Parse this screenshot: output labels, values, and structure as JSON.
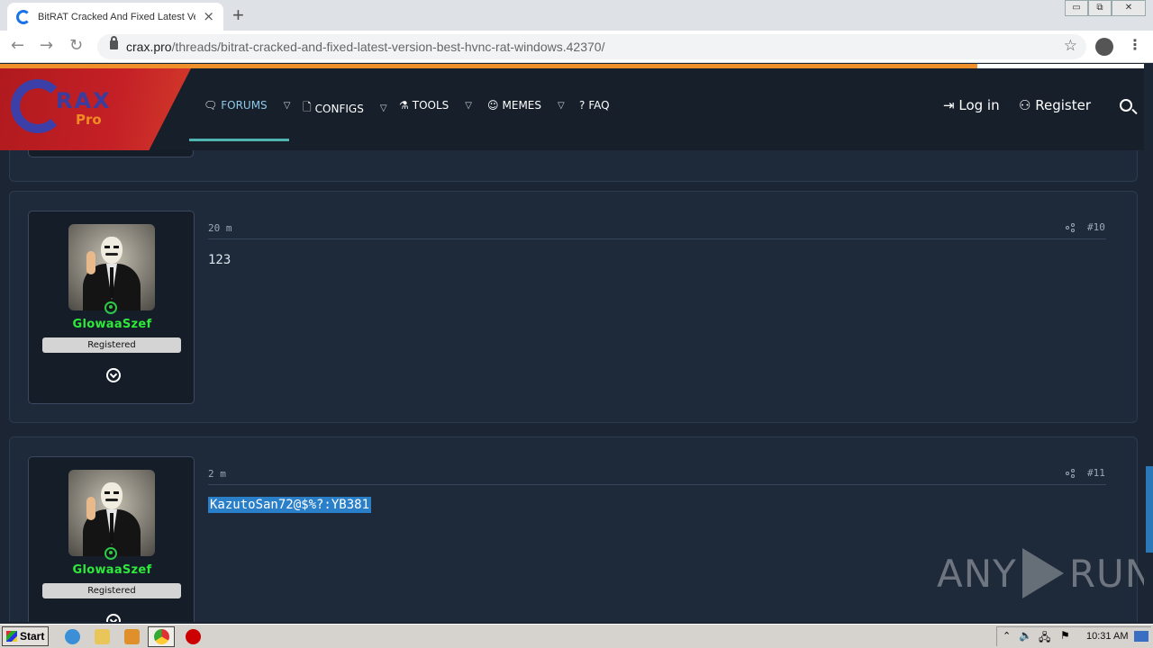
{
  "browser": {
    "tab_title": "BitRAT Cracked And Fixed Latest Ve",
    "tab_close": "×",
    "new_tab": "+",
    "url_host": "crax.pro",
    "url_path": "/threads/bitrat-cracked-and-fixed-latest-version-best-hvnc-rat-windows.42370/",
    "win_minimize": "▭",
    "win_restore": "⧉",
    "win_close": "✕"
  },
  "site": {
    "logo_text_main": "RAX",
    "logo_text_sub": "Pro",
    "nav": [
      {
        "label": "FORUMS",
        "icon": "chat-icon"
      },
      {
        "label": "CONFIGS",
        "icon": "file-icon"
      },
      {
        "label": "TOOLS",
        "icon": "flask-icon"
      },
      {
        "label": "MEMES",
        "icon": "mask-icon"
      },
      {
        "label": "FAQ",
        "icon": "question-icon"
      }
    ],
    "login_label": "Log in",
    "register_label": "Register",
    "accent_color": "#4fb3b0",
    "progress_color": "#f0902a"
  },
  "posts": [
    {
      "username": "GlowaaSzef",
      "role": "Registered",
      "time": "20 m",
      "number": "#10",
      "body": "123",
      "body_selected": false
    },
    {
      "username": "GlowaaSzef",
      "role": "Registered",
      "time": "2 m",
      "number": "#11",
      "body": "KazutoSan72@$%?:YB381",
      "body_selected": true
    }
  ],
  "watermark": {
    "left": "ANY",
    "right": "RUN"
  },
  "taskbar": {
    "start_label": "Start",
    "clock": "10:31 AM"
  }
}
